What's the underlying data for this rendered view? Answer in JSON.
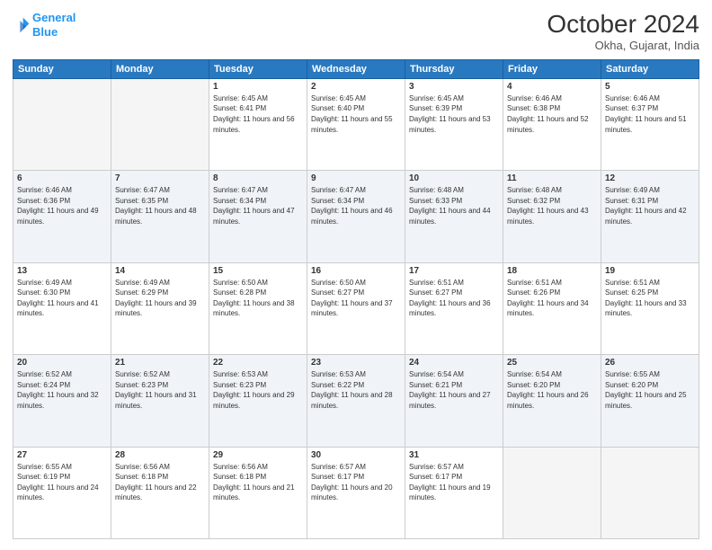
{
  "header": {
    "logo_line1": "General",
    "logo_line2": "Blue",
    "month": "October 2024",
    "location": "Okha, Gujarat, India"
  },
  "weekdays": [
    "Sunday",
    "Monday",
    "Tuesday",
    "Wednesday",
    "Thursday",
    "Friday",
    "Saturday"
  ],
  "weeks": [
    [
      {
        "day": "",
        "info": ""
      },
      {
        "day": "",
        "info": ""
      },
      {
        "day": "1",
        "info": "Sunrise: 6:45 AM\nSunset: 6:41 PM\nDaylight: 11 hours and 56 minutes."
      },
      {
        "day": "2",
        "info": "Sunrise: 6:45 AM\nSunset: 6:40 PM\nDaylight: 11 hours and 55 minutes."
      },
      {
        "day": "3",
        "info": "Sunrise: 6:45 AM\nSunset: 6:39 PM\nDaylight: 11 hours and 53 minutes."
      },
      {
        "day": "4",
        "info": "Sunrise: 6:46 AM\nSunset: 6:38 PM\nDaylight: 11 hours and 52 minutes."
      },
      {
        "day": "5",
        "info": "Sunrise: 6:46 AM\nSunset: 6:37 PM\nDaylight: 11 hours and 51 minutes."
      }
    ],
    [
      {
        "day": "6",
        "info": "Sunrise: 6:46 AM\nSunset: 6:36 PM\nDaylight: 11 hours and 49 minutes."
      },
      {
        "day": "7",
        "info": "Sunrise: 6:47 AM\nSunset: 6:35 PM\nDaylight: 11 hours and 48 minutes."
      },
      {
        "day": "8",
        "info": "Sunrise: 6:47 AM\nSunset: 6:34 PM\nDaylight: 11 hours and 47 minutes."
      },
      {
        "day": "9",
        "info": "Sunrise: 6:47 AM\nSunset: 6:34 PM\nDaylight: 11 hours and 46 minutes."
      },
      {
        "day": "10",
        "info": "Sunrise: 6:48 AM\nSunset: 6:33 PM\nDaylight: 11 hours and 44 minutes."
      },
      {
        "day": "11",
        "info": "Sunrise: 6:48 AM\nSunset: 6:32 PM\nDaylight: 11 hours and 43 minutes."
      },
      {
        "day": "12",
        "info": "Sunrise: 6:49 AM\nSunset: 6:31 PM\nDaylight: 11 hours and 42 minutes."
      }
    ],
    [
      {
        "day": "13",
        "info": "Sunrise: 6:49 AM\nSunset: 6:30 PM\nDaylight: 11 hours and 41 minutes."
      },
      {
        "day": "14",
        "info": "Sunrise: 6:49 AM\nSunset: 6:29 PM\nDaylight: 11 hours and 39 minutes."
      },
      {
        "day": "15",
        "info": "Sunrise: 6:50 AM\nSunset: 6:28 PM\nDaylight: 11 hours and 38 minutes."
      },
      {
        "day": "16",
        "info": "Sunrise: 6:50 AM\nSunset: 6:27 PM\nDaylight: 11 hours and 37 minutes."
      },
      {
        "day": "17",
        "info": "Sunrise: 6:51 AM\nSunset: 6:27 PM\nDaylight: 11 hours and 36 minutes."
      },
      {
        "day": "18",
        "info": "Sunrise: 6:51 AM\nSunset: 6:26 PM\nDaylight: 11 hours and 34 minutes."
      },
      {
        "day": "19",
        "info": "Sunrise: 6:51 AM\nSunset: 6:25 PM\nDaylight: 11 hours and 33 minutes."
      }
    ],
    [
      {
        "day": "20",
        "info": "Sunrise: 6:52 AM\nSunset: 6:24 PM\nDaylight: 11 hours and 32 minutes."
      },
      {
        "day": "21",
        "info": "Sunrise: 6:52 AM\nSunset: 6:23 PM\nDaylight: 11 hours and 31 minutes."
      },
      {
        "day": "22",
        "info": "Sunrise: 6:53 AM\nSunset: 6:23 PM\nDaylight: 11 hours and 29 minutes."
      },
      {
        "day": "23",
        "info": "Sunrise: 6:53 AM\nSunset: 6:22 PM\nDaylight: 11 hours and 28 minutes."
      },
      {
        "day": "24",
        "info": "Sunrise: 6:54 AM\nSunset: 6:21 PM\nDaylight: 11 hours and 27 minutes."
      },
      {
        "day": "25",
        "info": "Sunrise: 6:54 AM\nSunset: 6:20 PM\nDaylight: 11 hours and 26 minutes."
      },
      {
        "day": "26",
        "info": "Sunrise: 6:55 AM\nSunset: 6:20 PM\nDaylight: 11 hours and 25 minutes."
      }
    ],
    [
      {
        "day": "27",
        "info": "Sunrise: 6:55 AM\nSunset: 6:19 PM\nDaylight: 11 hours and 24 minutes."
      },
      {
        "day": "28",
        "info": "Sunrise: 6:56 AM\nSunset: 6:18 PM\nDaylight: 11 hours and 22 minutes."
      },
      {
        "day": "29",
        "info": "Sunrise: 6:56 AM\nSunset: 6:18 PM\nDaylight: 11 hours and 21 minutes."
      },
      {
        "day": "30",
        "info": "Sunrise: 6:57 AM\nSunset: 6:17 PM\nDaylight: 11 hours and 20 minutes."
      },
      {
        "day": "31",
        "info": "Sunrise: 6:57 AM\nSunset: 6:17 PM\nDaylight: 11 hours and 19 minutes."
      },
      {
        "day": "",
        "info": ""
      },
      {
        "day": "",
        "info": ""
      }
    ]
  ]
}
